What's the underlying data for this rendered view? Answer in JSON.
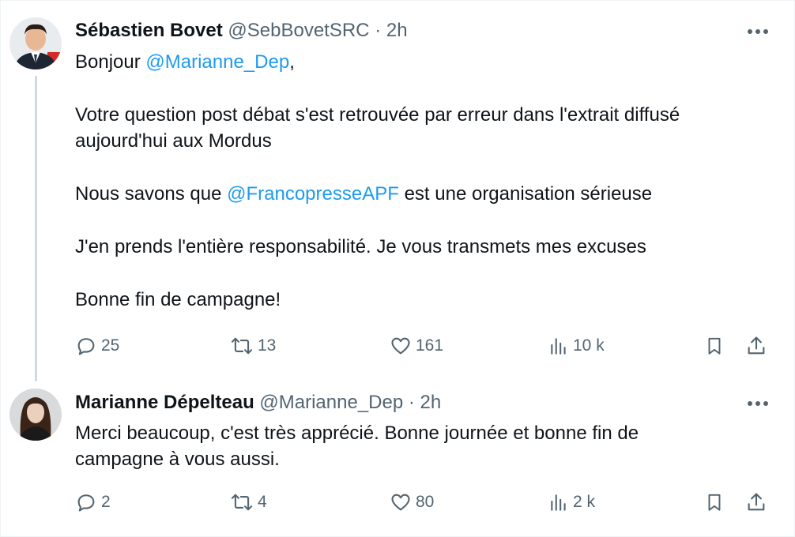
{
  "tweets": [
    {
      "author": {
        "name": "Sébastien Bovet",
        "handle": "@SebBovetSRC",
        "time": "2h"
      },
      "separator": "·",
      "body": {
        "line1_prefix": "Bonjour ",
        "line1_mention": "@Marianne_Dep",
        "line1_suffix": ",",
        "para2": "Votre question post débat s'est retrouvée par erreur dans l'extrait diffusé aujourd'hui aux Mordus",
        "para3_prefix": "Nous savons que ",
        "para3_mention": "@FrancopresseAPF",
        "para3_suffix": " est une organisation sérieuse",
        "para4": "J'en prends l'entière responsabilité. Je vous transmets mes excuses",
        "para5": "Bonne fin de campagne!"
      },
      "stats": {
        "replies": "25",
        "reposts": "13",
        "likes": "161",
        "views": "10 k"
      }
    },
    {
      "author": {
        "name": "Marianne Dépelteau",
        "handle": "@Marianne_Dep",
        "time": "2h"
      },
      "separator": "·",
      "body": {
        "text": "Merci beaucoup, c'est très apprécié. Bonne journée et bonne fin de campagne à vous aussi."
      },
      "stats": {
        "replies": "2",
        "reposts": "4",
        "likes": "80",
        "views": "2 k"
      }
    }
  ],
  "colors": {
    "text": "#0f1419",
    "secondary": "#536471",
    "link": "#1d9bf0",
    "thread_line": "#cfd9de"
  },
  "icons": [
    "reply-icon",
    "repost-icon",
    "like-icon",
    "views-icon",
    "bookmark-icon",
    "share-icon",
    "more-icon"
  ]
}
